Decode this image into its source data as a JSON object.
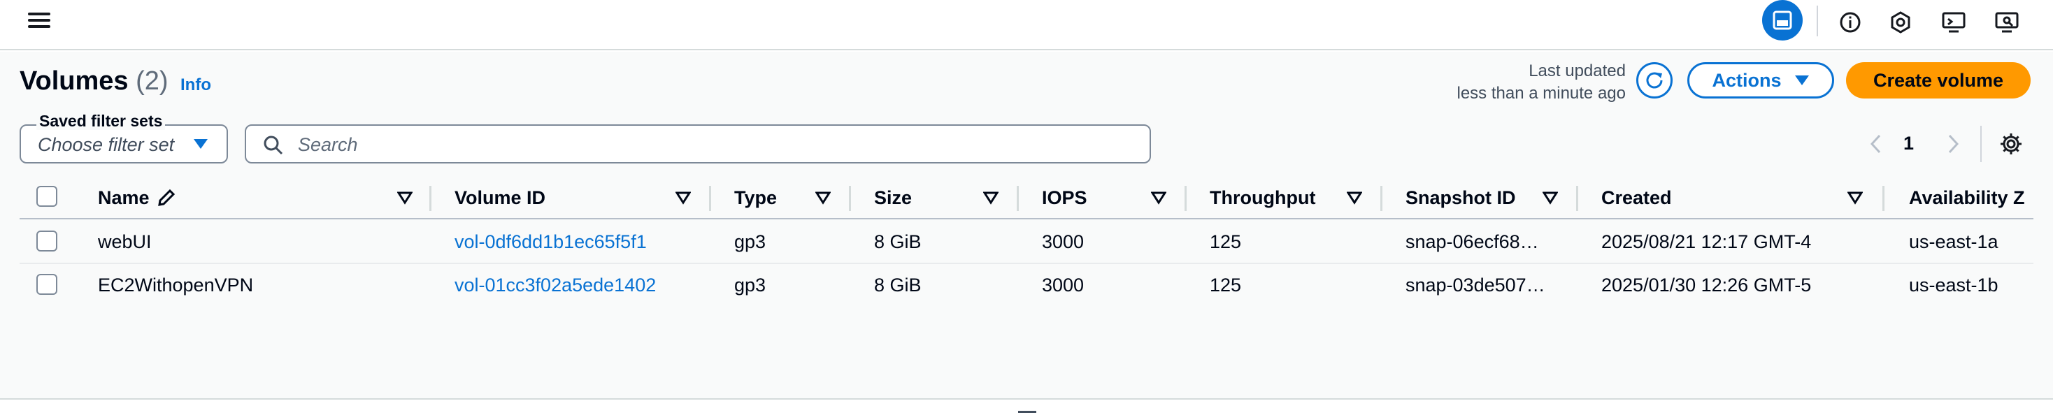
{
  "topbar": {
    "icons": [
      "menu-icon",
      "split-panel-icon",
      "info-icon",
      "shield-hex-icon",
      "display-settings-icon",
      "preview-icon"
    ]
  },
  "page": {
    "title": "Volumes",
    "count": "(2)",
    "info_link": "Info",
    "last_updated_line1": "Last updated",
    "last_updated_line2": "less than a minute ago",
    "actions_label": "Actions",
    "create_label": "Create volume"
  },
  "filters": {
    "saved_label": "Saved filter sets",
    "saved_placeholder": "Choose filter set",
    "search_placeholder": "Search"
  },
  "pagination": {
    "current_page": "1"
  },
  "table": {
    "columns": [
      "Name",
      "Volume ID",
      "Type",
      "Size",
      "IOPS",
      "Throughput",
      "Snapshot ID",
      "Created",
      "Availability Z"
    ],
    "rows": [
      {
        "name": "webUI",
        "volume_id": "vol-0df6dd1b1ec65f5f1",
        "type": "gp3",
        "size": "8 GiB",
        "iops": "3000",
        "throughput": "125",
        "snapshot_id": "snap-06ecf68…",
        "created": "2025/08/21 12:17 GMT-4",
        "az": "us-east-1a"
      },
      {
        "name": "EC2WithopenVPN",
        "volume_id": "vol-01cc3f02a5ede1402",
        "type": "gp3",
        "size": "8 GiB",
        "iops": "3000",
        "throughput": "125",
        "snapshot_id": "snap-03de507…",
        "created": "2025/01/30 12:26 GMT-5",
        "az": "us-east-1b"
      }
    ]
  },
  "colors": {
    "accent": "#0972d3",
    "primary_button": "#ff9900",
    "text": "#000716"
  }
}
